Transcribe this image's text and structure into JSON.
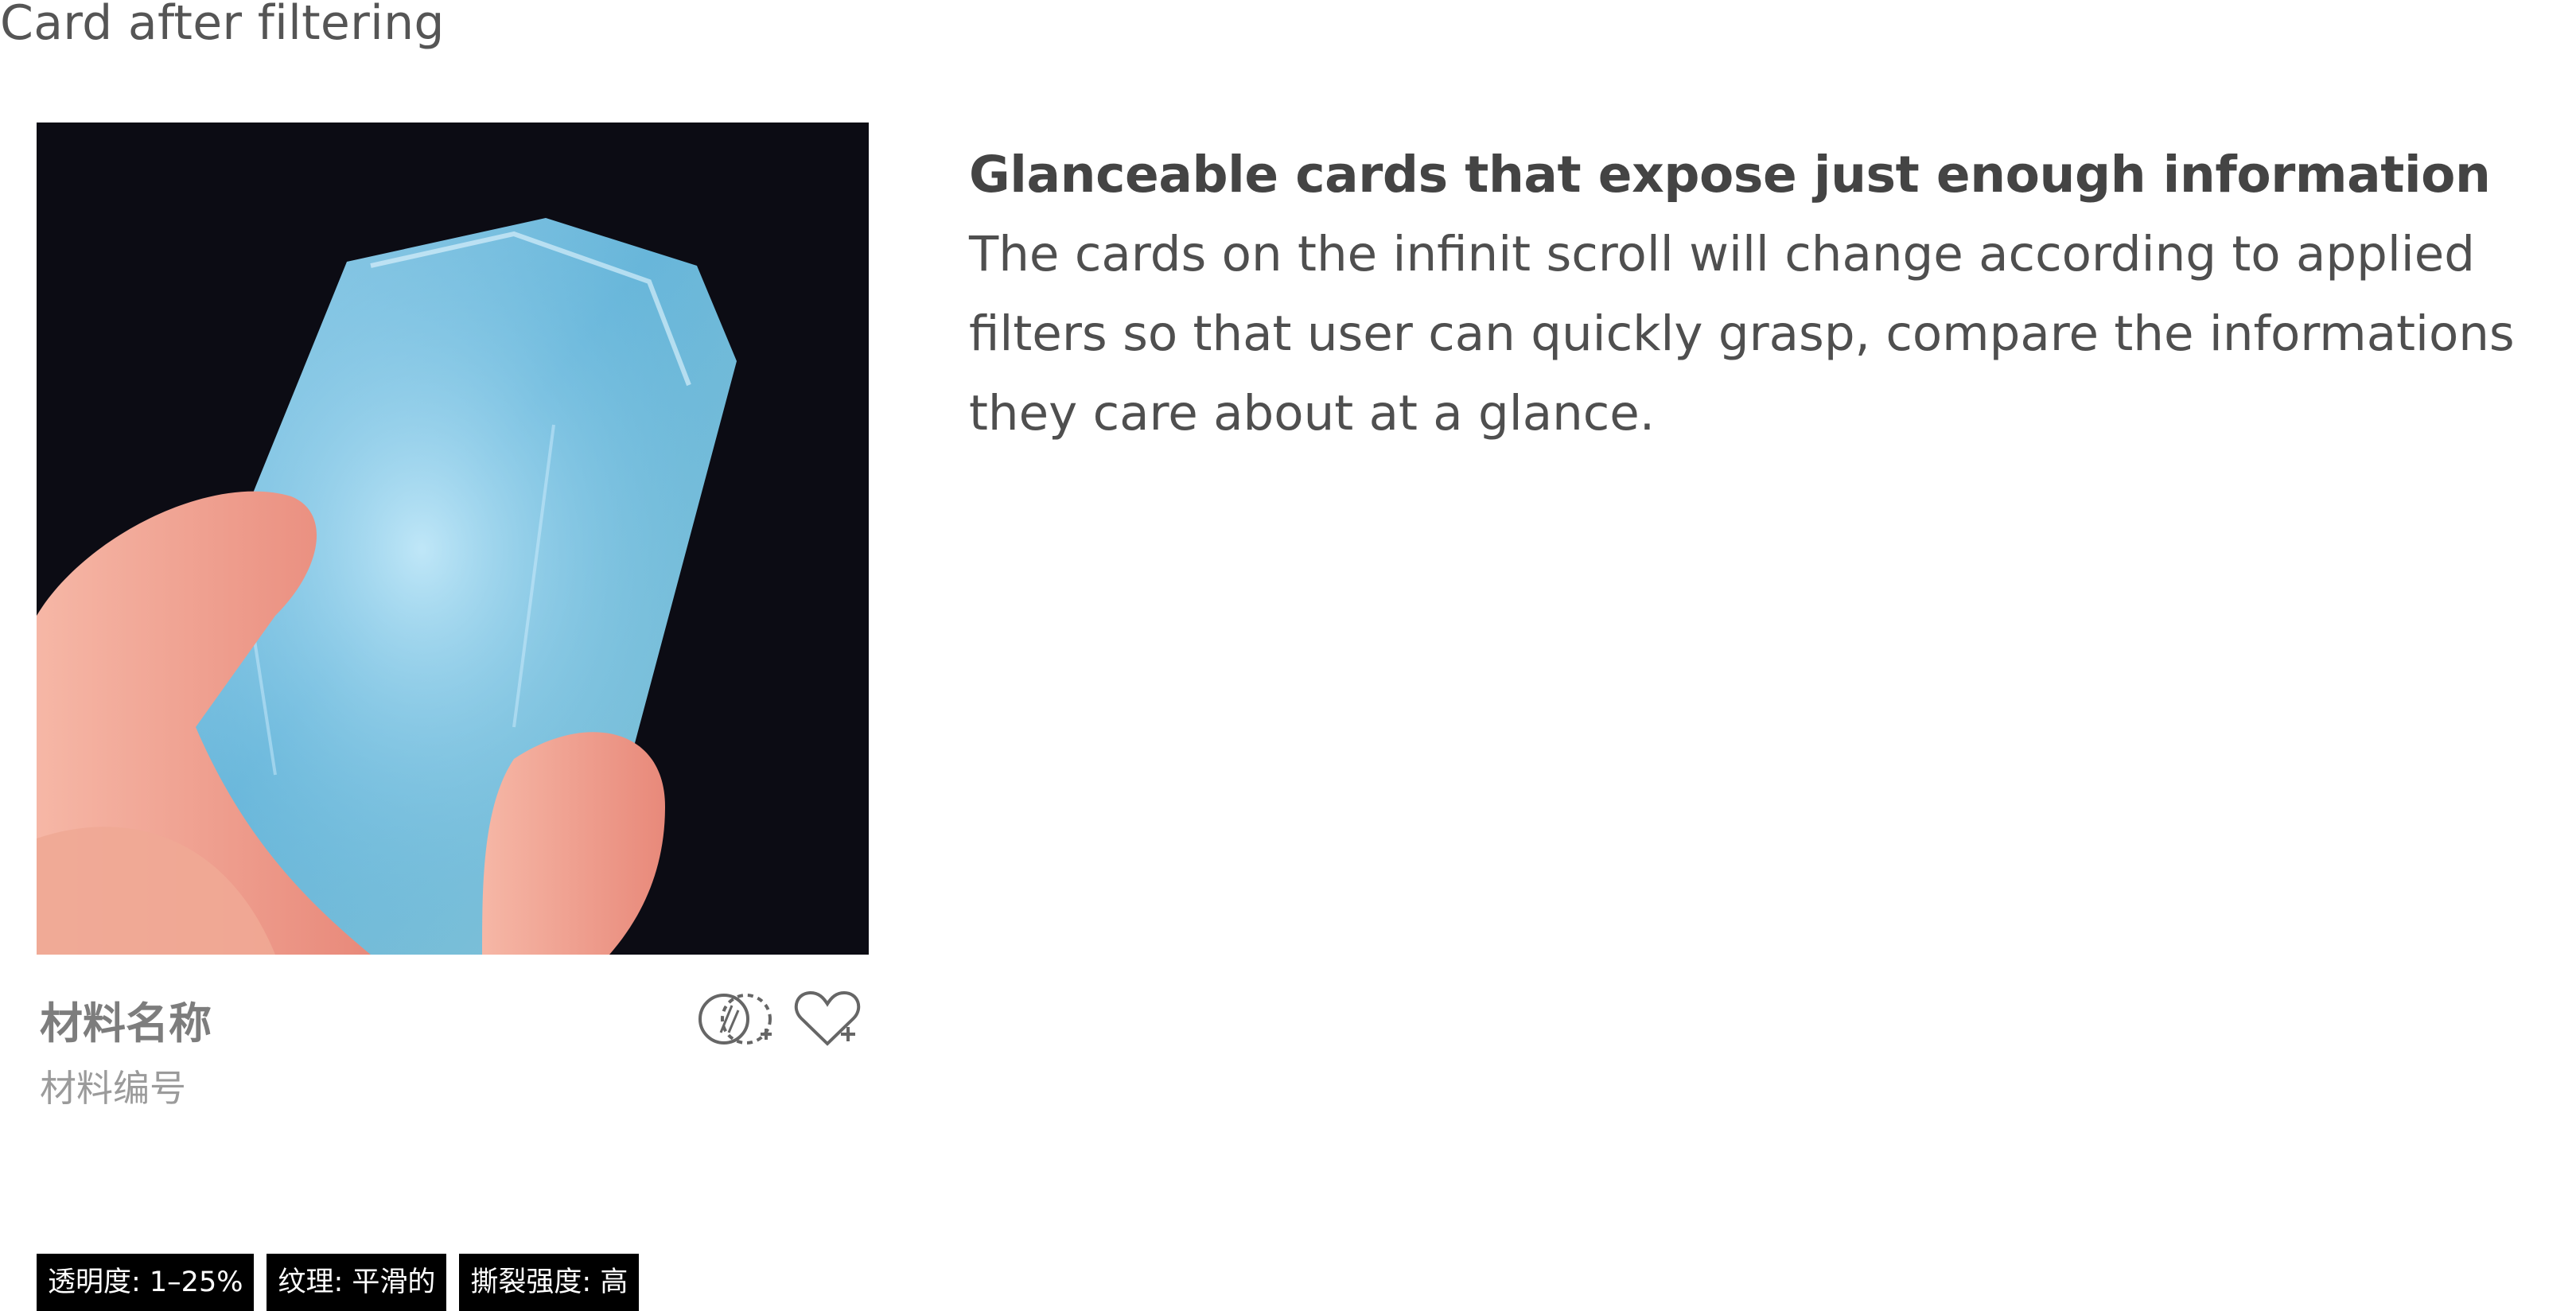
{
  "page": {
    "section_title": "Card after filtering"
  },
  "card": {
    "image_alt": "Translucent blue material sample held between fingers",
    "name": "材料名称",
    "code": "材料编号",
    "actions": {
      "compare_icon": "compare-add-icon",
      "favorite_icon": "heart-add-icon"
    },
    "tags": [
      {
        "label": "透明度: 1–25%"
      },
      {
        "label": "纹理: 平滑的"
      },
      {
        "label": "撕裂强度: 高"
      }
    ]
  },
  "description": {
    "title": "Glanceable cards that expose just enough information",
    "body": "The cards on the infinit scroll will change according to applied filters so that user can quickly grasp, compare the informations they care about at a glance."
  },
  "colors": {
    "tag_bg": "#000000",
    "tag_text": "#ffffff",
    "image_bg": "#0c0c14",
    "material_blue": "#7fc6e6"
  }
}
